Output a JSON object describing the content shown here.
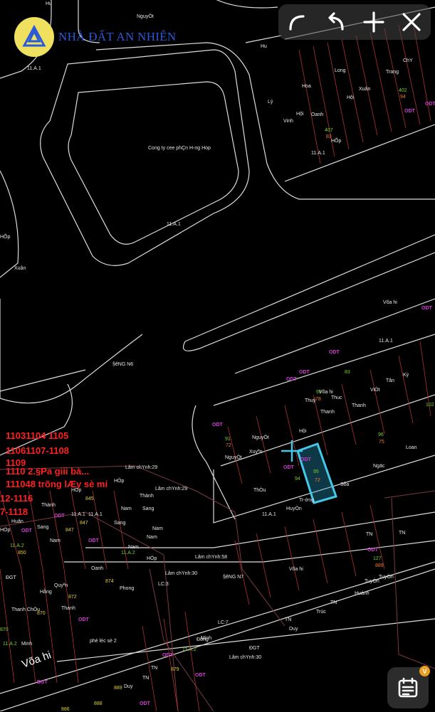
{
  "toolbar": {
    "buttons": [
      {
        "name": "redo",
        "icon": "curve-arrow-icon"
      },
      {
        "name": "undo",
        "icon": "undo-icon"
      },
      {
        "name": "add",
        "icon": "plus-icon"
      },
      {
        "name": "close",
        "icon": "close-icon"
      }
    ]
  },
  "logo": {
    "text": "NHÀ ĐẤT AN NHIÊN",
    "accent": "#2a5ad8"
  },
  "fab": {
    "icon": "calendar-note-icon",
    "badge": "V"
  },
  "map": {
    "company": "Cong ty cee phÇn H-ng Hop",
    "streets": {
      "n6": "§­êNG N6",
      "n7": "§­êNG N7",
      "phu_loc": "phè léc sè 2",
      "vo_thi": "Võa hi"
    },
    "red_notes": [
      "11031104 1105",
      "11061107-1108",
      "1109",
      "1110 2.§Pa giíi bà...",
      "111048 trõng lÆy sè mí",
      "12-1116",
      "7-1118"
    ],
    "names": [
      "Hu",
      "Long",
      "Trang",
      "ChY",
      "Hoa",
      "Xuân",
      "Lý",
      "Hội",
      "Oanh",
      "Vinh",
      "HÕp",
      "Xuân",
      "Võa hi",
      "Thuý",
      "Thuc",
      "Thanh",
      "Tân",
      "Kỳ",
      "ViÖt",
      "NguyÖt",
      "Loan",
      "Ngäc",
      "Xuyªn",
      "Sồa",
      "ThÒu",
      "Tr-ờng",
      "HuyÒn",
      "HÖp",
      "Oanh",
      "Quyªn",
      "Phong",
      "Hằng",
      "Thanh",
      "Thanh ChÒu",
      "Lâm chYnh:29",
      "Lâm chYnh:58",
      "Lâm chYnh:30",
      "Huân",
      "Thành",
      "Nam",
      "Sang",
      "TuyÒn",
      "Huánh",
      "Trúc",
      "TN",
      "Duy",
      "ĐGT",
      "Minh",
      "Đông"
    ],
    "codes": [
      "ODT",
      "11.A.1",
      "11.A.2",
      "LC:3",
      "LC:7"
    ],
    "numbers": [
      "407",
      "83",
      "402",
      "94",
      "95",
      "78",
      "96",
      "75",
      "91",
      "72",
      "102",
      "127",
      "63",
      "845",
      "847",
      "850",
      "870",
      "872",
      "874",
      "879",
      "886",
      "888",
      "889",
      "110",
      "127"
    ]
  }
}
